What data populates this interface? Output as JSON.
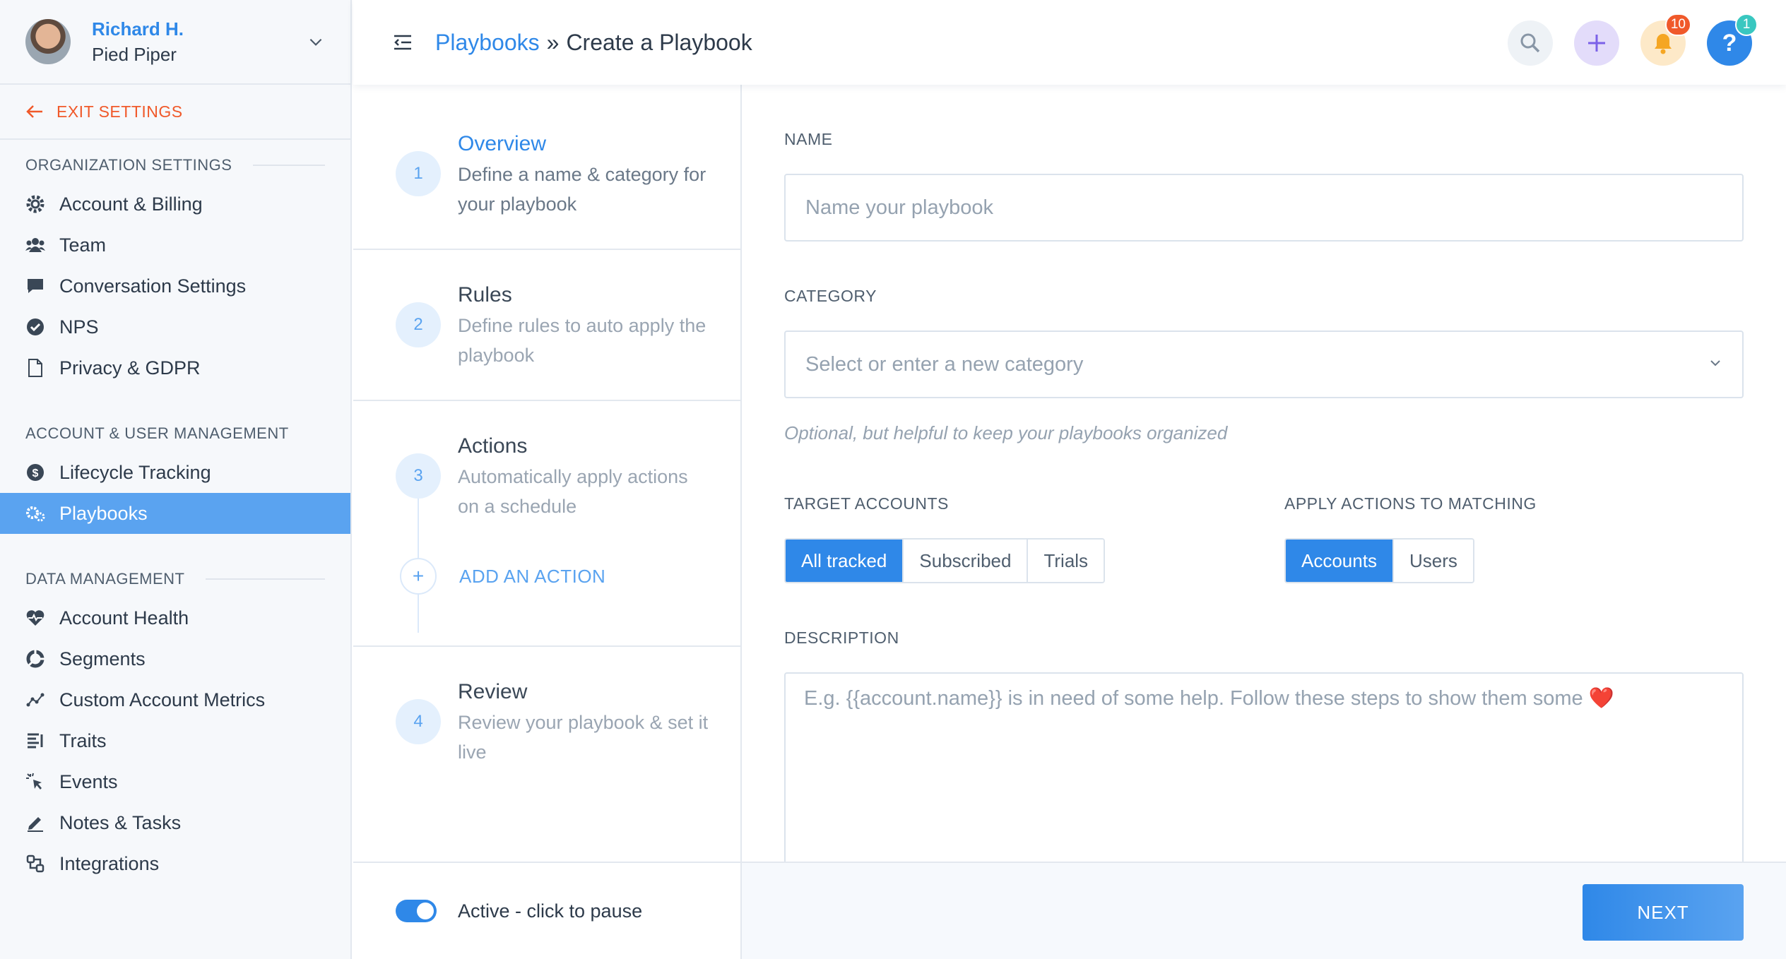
{
  "user": {
    "name": "Richard H.",
    "org": "Pied Piper"
  },
  "exit_label": "EXIT SETTINGS",
  "sections": [
    {
      "title": "ORGANIZATION SETTINGS",
      "items": [
        {
          "label": "Account & Billing",
          "icon": "gear-icon"
        },
        {
          "label": "Team",
          "icon": "team-icon"
        },
        {
          "label": "Conversation Settings",
          "icon": "chat-icon"
        },
        {
          "label": "NPS",
          "icon": "check-circle-icon"
        },
        {
          "label": "Privacy & GDPR",
          "icon": "document-icon"
        }
      ]
    },
    {
      "title": "ACCOUNT & USER MANAGEMENT",
      "items": [
        {
          "label": "Lifecycle Tracking",
          "icon": "dollar-circle-icon"
        },
        {
          "label": "Playbooks",
          "icon": "playbook-gears-icon",
          "active": true
        }
      ]
    },
    {
      "title": "DATA MANAGEMENT",
      "items": [
        {
          "label": "Account Health",
          "icon": "heart-pulse-icon"
        },
        {
          "label": "Segments",
          "icon": "pie-segments-icon"
        },
        {
          "label": "Custom Account Metrics",
          "icon": "metrics-icon"
        },
        {
          "label": "Traits",
          "icon": "traits-list-icon"
        },
        {
          "label": "Events",
          "icon": "cursor-click-icon"
        },
        {
          "label": "Notes & Tasks",
          "icon": "pencil-icon"
        },
        {
          "label": "Integrations",
          "icon": "integrations-icon"
        }
      ]
    }
  ],
  "header": {
    "crumb_link": "Playbooks",
    "crumb_sep": "»",
    "crumb_current": "Create a Playbook",
    "notifications_count": "10",
    "help_count": "1"
  },
  "steps": [
    {
      "num": "1",
      "title": "Overview",
      "desc": "Define a name & category for your playbook"
    },
    {
      "num": "2",
      "title": "Rules",
      "desc": "Define rules to auto apply the playbook"
    },
    {
      "num": "3",
      "title": "Actions",
      "desc": "Automatically apply actions on a schedule"
    },
    {
      "num": "4",
      "title": "Review",
      "desc": "Review your playbook & set it live"
    }
  ],
  "add_action": {
    "symbol": "+",
    "label": "ADD AN ACTION"
  },
  "toggle_label": "Active - click to pause",
  "next_label": "NEXT",
  "form": {
    "name_label": "NAME",
    "name_placeholder": "Name your playbook",
    "category_label": "CATEGORY",
    "category_placeholder": "Select or enter a new category",
    "category_hint": "Optional, but helpful to keep your playbooks organized",
    "target_label": "TARGET ACCOUNTS",
    "target_options": [
      "All tracked",
      "Subscribed",
      "Trials"
    ],
    "target_selected": "All tracked",
    "apply_label": "APPLY ACTIONS TO MATCHING",
    "apply_options": [
      "Accounts",
      "Users"
    ],
    "apply_selected": "Accounts",
    "description_label": "DESCRIPTION",
    "description_placeholder": "E.g. {{account.name}} is in need of some help. Follow these steps to show them some ❤️"
  },
  "colors": {
    "accent": "#2f88e8",
    "exit": "#f0592a",
    "active_nav": "#5aa3f0"
  }
}
